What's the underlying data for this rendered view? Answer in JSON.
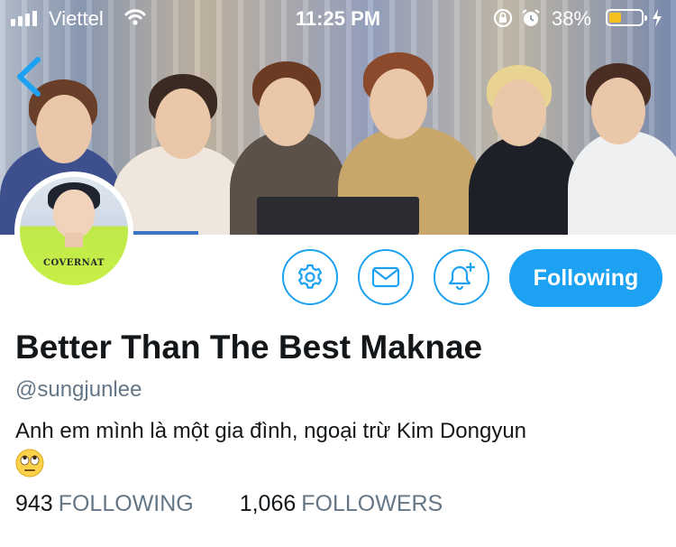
{
  "status_bar": {
    "carrier": "Viettel",
    "time": "11:25 PM",
    "battery_percent": "38%",
    "battery_level": 0.38,
    "icons": [
      "signal-icon",
      "wifi-icon",
      "orientation-lock-icon",
      "alarm-icon",
      "battery-icon",
      "charging-bolt-icon"
    ]
  },
  "header": {
    "back_icon": "chevron-left-icon"
  },
  "avatar": {
    "shirt_text": "COVERNAT"
  },
  "actions": {
    "settings_icon": "gear-icon",
    "message_icon": "envelope-icon",
    "notify_icon": "bell-plus-icon",
    "follow_label": "Following"
  },
  "profile": {
    "display_name": "Better Than The Best Maknae",
    "handle": "@sungjunlee",
    "bio": "Anh em mình là một gia đình, ngoại trừ Kim Dongyun",
    "bio_emoji": "face-with-rolling-eyes-icon",
    "following_count": "943",
    "following_label": "FOLLOWING",
    "followers_count": "1,066",
    "followers_label": "FOLLOWERS"
  },
  "colors": {
    "accent": "#1da1f2",
    "secondary_text": "#657786",
    "primary_text": "#14171a",
    "battery_fill": "#f5c01e"
  }
}
